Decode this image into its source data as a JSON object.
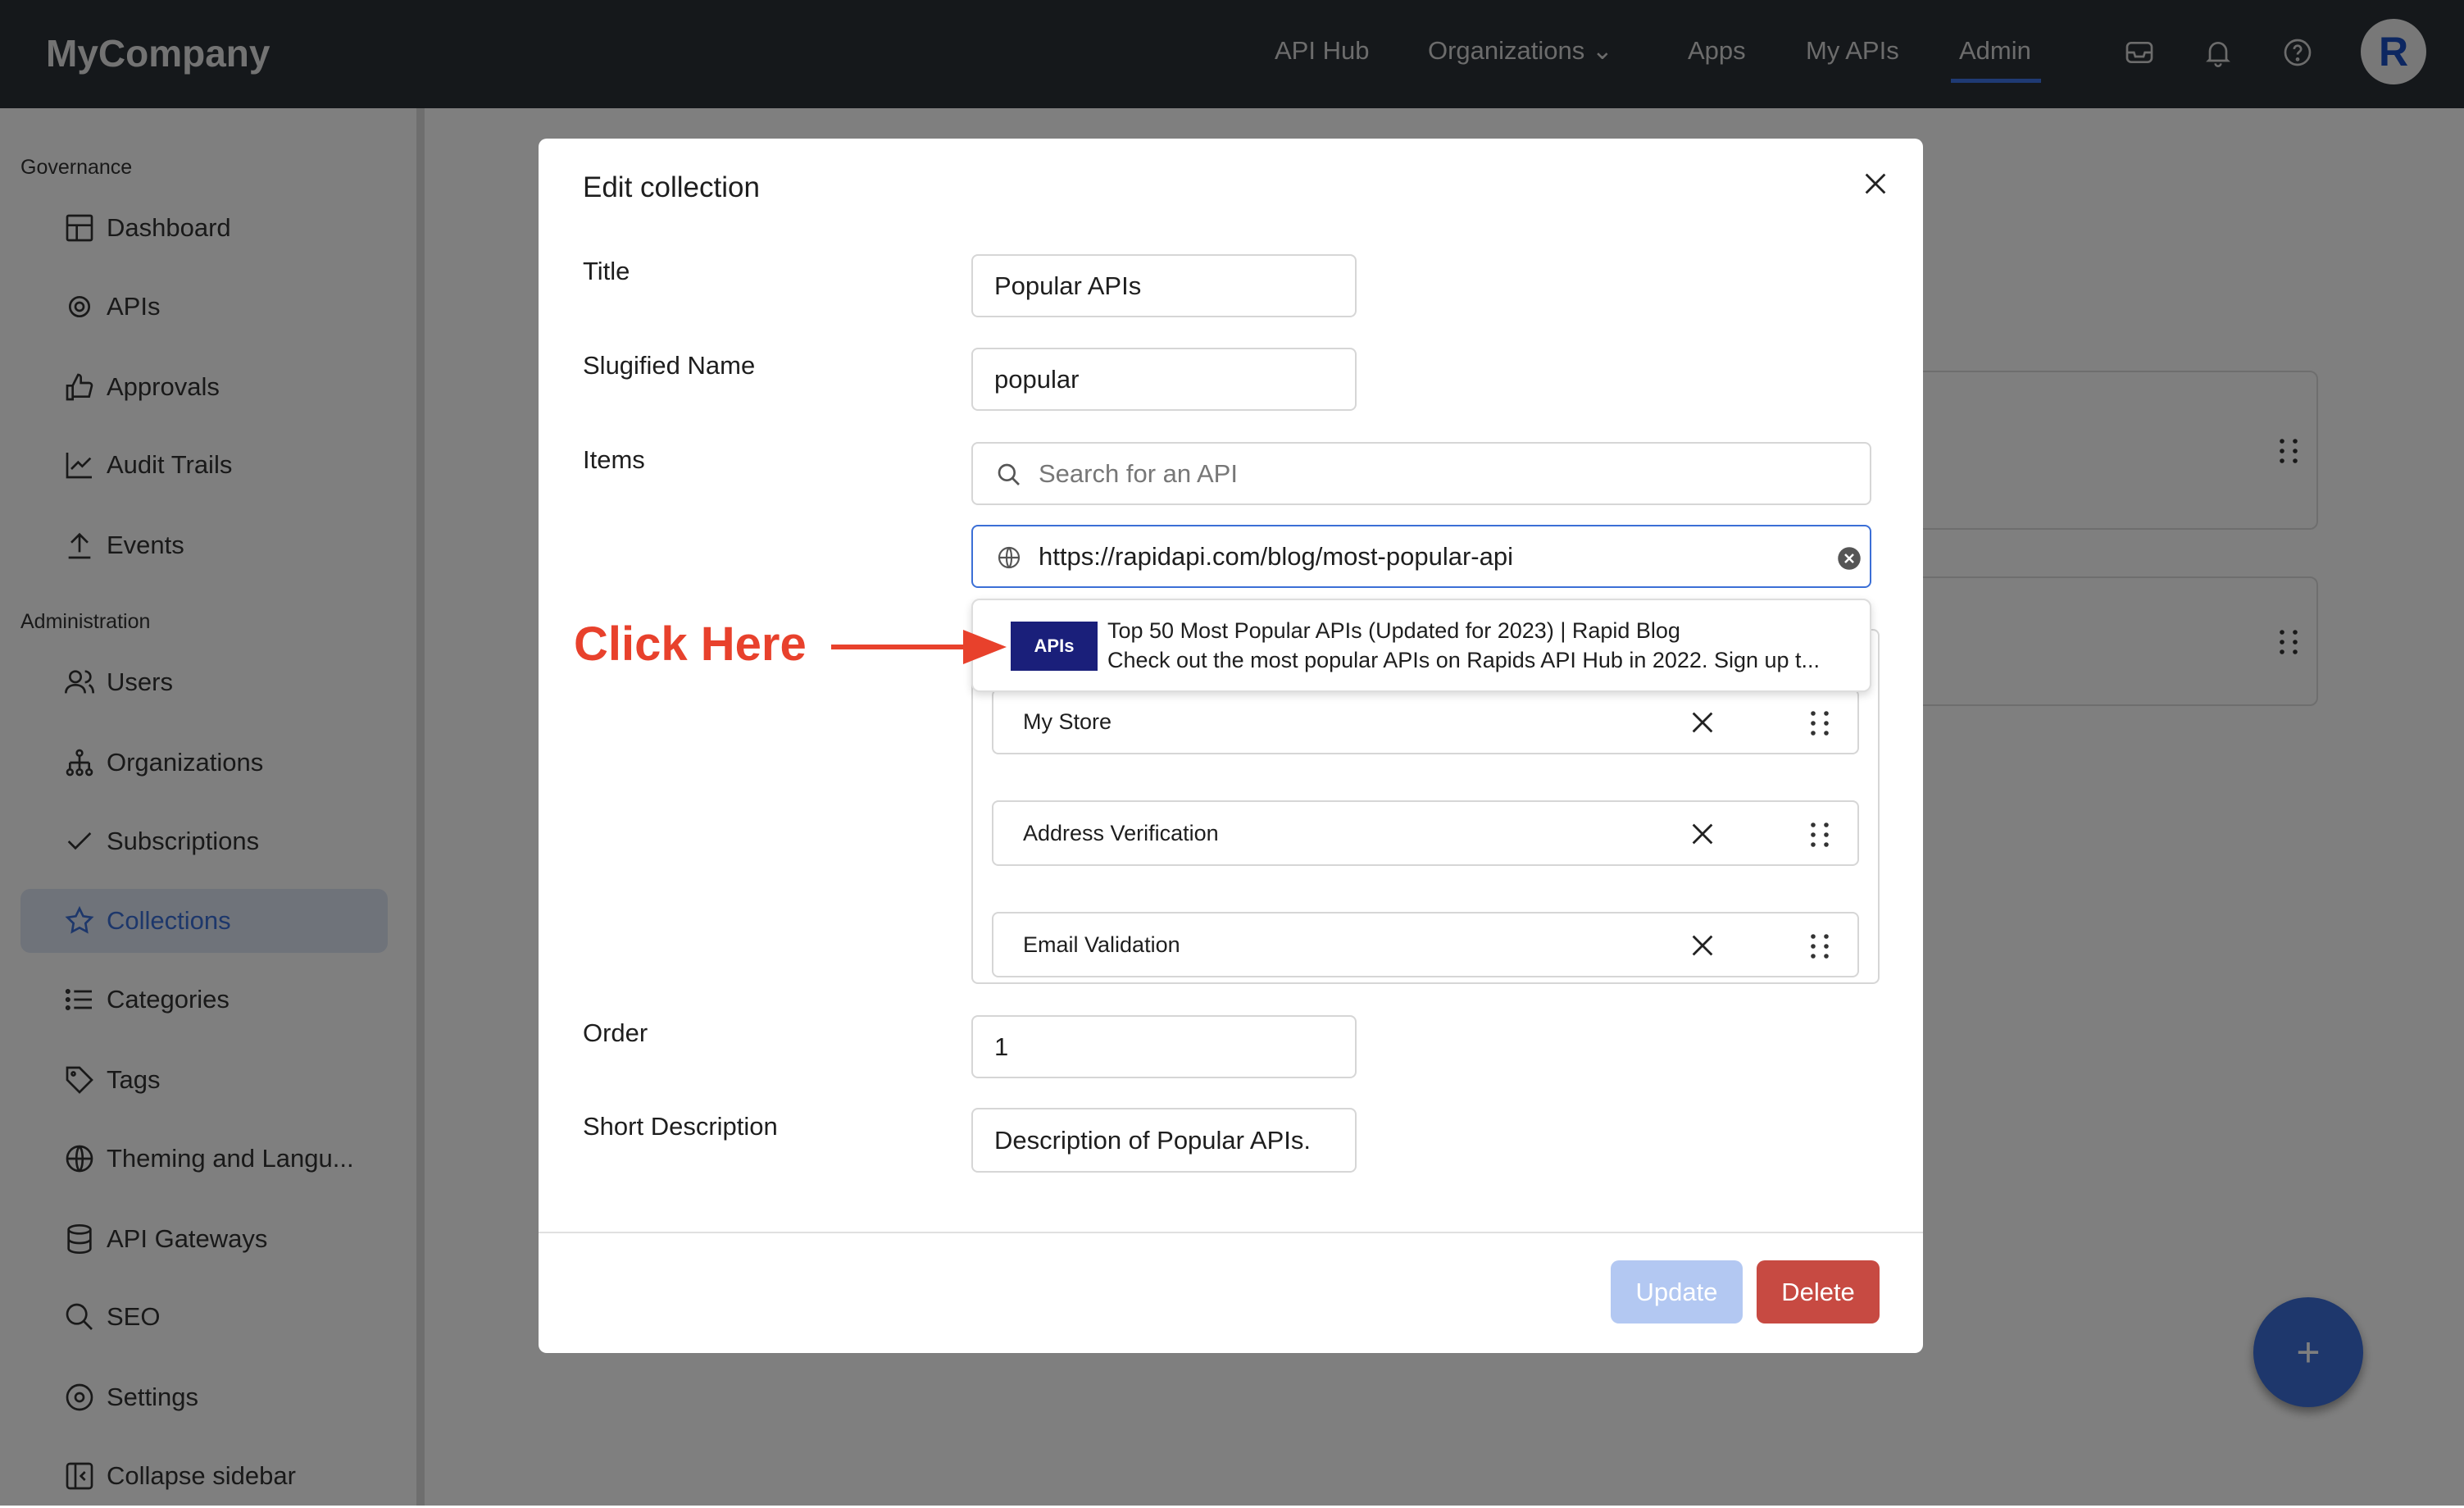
{
  "nav": {
    "logo": "MyCompany",
    "items": [
      "API Hub",
      "Organizations",
      "Apps",
      "My APIs",
      "Admin"
    ],
    "active": "Admin",
    "avatar_letter": "R"
  },
  "sidebar": {
    "sections": [
      "Governance",
      "Administration"
    ],
    "items": [
      {
        "label": "Dashboard",
        "icon": "dashboard-icon"
      },
      {
        "label": "APIs",
        "icon": "api-icon"
      },
      {
        "label": "Approvals",
        "icon": "thumbs-up-icon"
      },
      {
        "label": "Audit Trails",
        "icon": "chart-line-icon"
      },
      {
        "label": "Events",
        "icon": "upload-icon"
      },
      {
        "label": "Users",
        "icon": "users-icon"
      },
      {
        "label": "Organizations",
        "icon": "org-tree-icon"
      },
      {
        "label": "Subscriptions",
        "icon": "check-icon"
      },
      {
        "label": "Collections",
        "icon": "star-icon"
      },
      {
        "label": "Categories",
        "icon": "list-icon"
      },
      {
        "label": "Tags",
        "icon": "tag-icon"
      },
      {
        "label": "Theming and Langu...",
        "icon": "globe-icon"
      },
      {
        "label": "API Gateways",
        "icon": "database-icon"
      },
      {
        "label": "SEO",
        "icon": "search-icon"
      },
      {
        "label": "Settings",
        "icon": "settings-icon"
      },
      {
        "label": "Collapse sidebar",
        "icon": "collapse-icon"
      }
    ],
    "active": "Collections"
  },
  "modal": {
    "title": "Edit collection",
    "labels": {
      "title": "Title",
      "slug": "Slugified Name",
      "items": "Items",
      "order": "Order",
      "short_description": "Short Description"
    },
    "values": {
      "title": "Popular APIs",
      "slug": "popular",
      "order": "1",
      "short_description": "Description of Popular APIs."
    },
    "search_placeholder": "Search for an API",
    "url_value": "https://rapidapi.com/blog/most-popular-api",
    "suggestion": {
      "title": "Top 50 Most Popular APIs (Updated for 2023) | Rapid Blog",
      "description": "Check out the most popular APIs on Rapids API Hub in 2022. Sign up t...",
      "thumb_text": "APIs"
    },
    "items": [
      "My Store",
      "Address Verification",
      "Email Validation"
    ],
    "update_label": "Update",
    "delete_label": "Delete"
  },
  "annotation": {
    "text": "Click Here",
    "color": "#e8412c"
  },
  "colors": {
    "accent": "#3b6fd6",
    "delete": "#c74a42",
    "update_disabled": "#b3c8f2",
    "fab": "#1f3a6e"
  }
}
